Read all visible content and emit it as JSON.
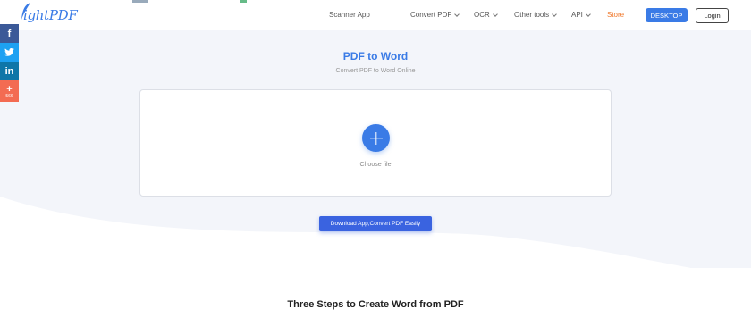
{
  "header": {
    "logo_text": "ightPDF",
    "nav": [
      {
        "label": "Scanner App",
        "dropdown": false
      },
      {
        "label": "Convert PDF",
        "dropdown": true
      },
      {
        "label": "OCR",
        "dropdown": true
      },
      {
        "label": "Other tools",
        "dropdown": true
      },
      {
        "label": "API",
        "dropdown": true
      },
      {
        "label": "Store",
        "dropdown": false
      }
    ],
    "desktop_label": "DESKTOP",
    "login_label": "Login"
  },
  "share": {
    "facebook": "f",
    "twitter": "twitter-icon",
    "linkedin": "in",
    "plus": "+",
    "plus_count": "566"
  },
  "hero": {
    "title": "PDF to Word",
    "subtitle": "Convert PDF to Word Online",
    "choose_label": "Choose file",
    "download_label": "Download App,Convert PDF Easily"
  },
  "steps_heading": "Three Steps to Create Word from PDF",
  "colors": {
    "accent": "#3a7be6",
    "store": "#f0782b",
    "facebook": "#3b5998",
    "twitter": "#1da1f2",
    "linkedin": "#0e76a8",
    "plus": "#f36b52"
  }
}
